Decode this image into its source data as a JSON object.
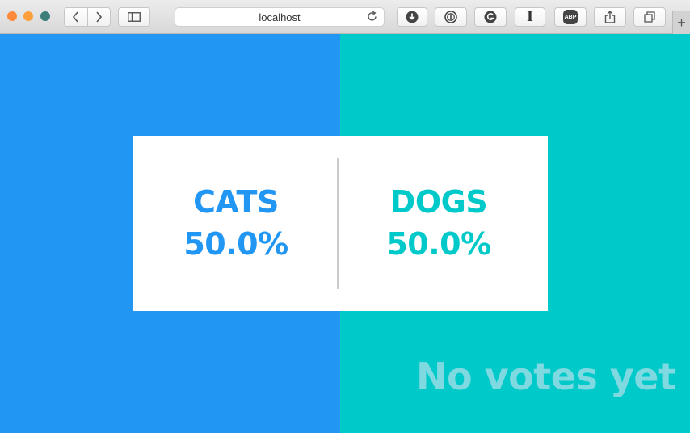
{
  "browser": {
    "url": "localhost",
    "icons": [
      "back-icon",
      "forward-icon",
      "sidebar-icon",
      "reload-icon",
      "download-icon",
      "onepassword-icon",
      "grammarly-icon",
      "instapaper-icon",
      "adblock-icon",
      "share-icon",
      "tabs-icon",
      "new-tab-icon"
    ],
    "adblock_label": "ABP",
    "instapaper_label": "I"
  },
  "colors": {
    "cats": "#2196f3",
    "dogs": "#00c9c9",
    "no_votes": "#7fd9e0",
    "light_close": "#fd8a3a",
    "light_minimize": "#fd9f3a",
    "light_zoom": "#3d7d7a"
  },
  "poll": {
    "cats": {
      "label": "CATS",
      "percent": "50.0%"
    },
    "dogs": {
      "label": "DOGS",
      "percent": "50.0%"
    },
    "status": "No votes yet"
  }
}
